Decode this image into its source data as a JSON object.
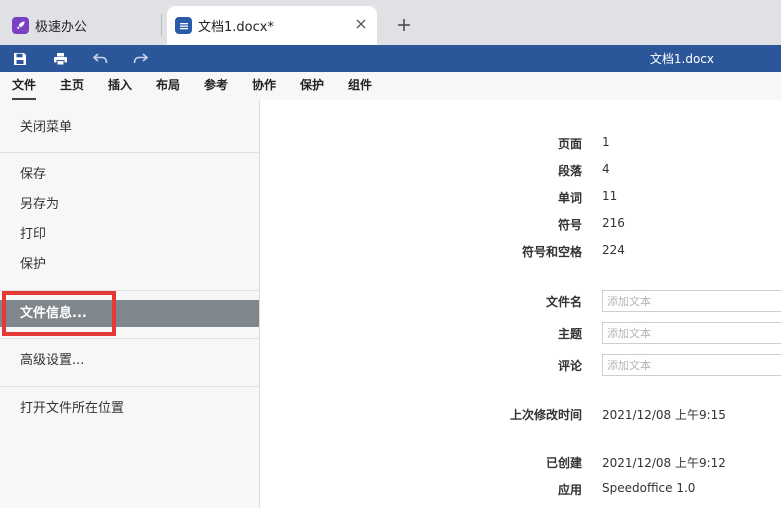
{
  "tabs": [
    {
      "title": "极速办公"
    },
    {
      "title": "文档1.docx*"
    }
  ],
  "toolbar": {
    "doc_title": "文档1.docx"
  },
  "menu": [
    "文件",
    "主页",
    "插入",
    "布局",
    "参考",
    "协作",
    "保护",
    "组件"
  ],
  "sidebar": {
    "close": "关闭菜单",
    "save": "保存",
    "save_as": "另存为",
    "print": "打印",
    "protect": "保护",
    "file_info": "文件信息...",
    "advanced": "高级设置...",
    "open_location": "打开文件所在位置"
  },
  "info": {
    "pages_label": "页面",
    "pages": "1",
    "paragraphs_label": "段落",
    "paragraphs": "4",
    "words_label": "单词",
    "words": "11",
    "symbols_label": "符号",
    "symbols": "216",
    "symbols_spaces_label": "符号和空格",
    "symbols_spaces": "224",
    "filename_label": "文件名",
    "subject_label": "主题",
    "comment_label": "评论",
    "placeholder": "添加文本",
    "modified_label": "上次修改时间",
    "modified": "2021/12/08 上午9:15",
    "created_label": "已创建",
    "created": "2021/12/08 上午9:12",
    "app_label": "应用",
    "app": "Speedoffice 1.0"
  },
  "colors": {
    "toolbar": "#2b579a",
    "selected": "#7f868c",
    "highlight": "#e53935"
  }
}
